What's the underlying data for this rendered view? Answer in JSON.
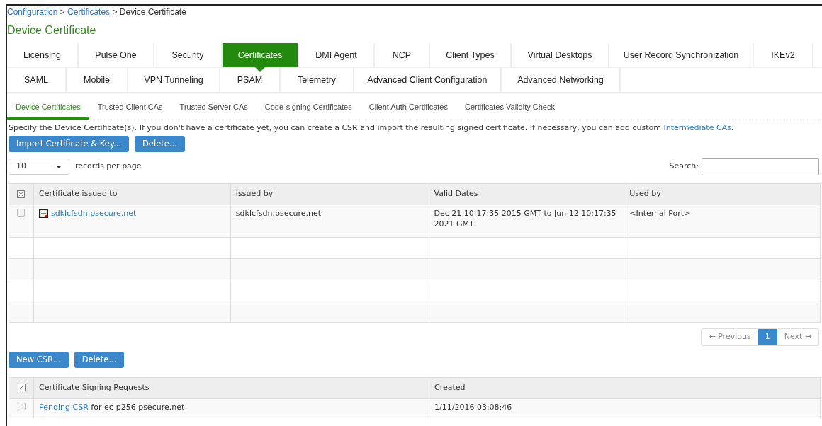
{
  "breadcrumb_separator": ">",
  "breadcrumb": [
    {
      "label": "Configuration",
      "link": true
    },
    {
      "label": "Certificates",
      "link": true
    },
    {
      "label": "Device Certificate",
      "link": false
    }
  ],
  "title": "Device Certificate",
  "tab_rows": [
    [
      {
        "label": "Licensing",
        "selected": false
      },
      {
        "label": "Pulse One",
        "selected": false
      },
      {
        "label": "Security",
        "selected": false
      },
      {
        "label": "Certificates",
        "selected": true
      },
      {
        "label": "DMI Agent",
        "selected": false
      },
      {
        "label": "NCP",
        "selected": false
      },
      {
        "label": "Client Types",
        "selected": false
      },
      {
        "label": "Virtual Desktops",
        "selected": false
      },
      {
        "label": "User Record Synchronization",
        "selected": false
      },
      {
        "label": "IKEv2",
        "selected": false
      }
    ],
    [
      {
        "label": "SAML",
        "selected": false
      },
      {
        "label": "Mobile",
        "selected": false
      },
      {
        "label": "VPN Tunneling",
        "selected": false
      },
      {
        "label": "PSAM",
        "selected": false
      },
      {
        "label": "Telemetry",
        "selected": false
      },
      {
        "label": "Advanced Client Configuration",
        "selected": false
      },
      {
        "label": "Advanced Networking",
        "selected": false
      }
    ]
  ],
  "subtabs": [
    {
      "label": "Device Certificates",
      "selected": true
    },
    {
      "label": "Trusted Client CAs",
      "selected": false
    },
    {
      "label": "Trusted Server CAs",
      "selected": false
    },
    {
      "label": "Code-signing Certificates",
      "selected": false
    },
    {
      "label": "Client Auth Certificates",
      "selected": false
    },
    {
      "label": "Certificates Validity Check",
      "selected": false
    }
  ],
  "description": {
    "text": "Specify the Device Certificate(s). If you don't have a certificate yet, you can create a CSR and import the resulting signed certificate. If necessary, you can add custom ",
    "link": "Intermediate CAs",
    "end": "."
  },
  "buttons": [
    "Import Certificate & Key...",
    "Delete..."
  ],
  "page_size": {
    "value": "10",
    "label": "records per page"
  },
  "search": {
    "label": "Search:"
  },
  "certificates": {
    "columns": [
      "Certificate issued to",
      "Issued by",
      "Valid Dates",
      "Used by"
    ],
    "rows": [
      {
        "checked": false,
        "issued_to": "sdklcfsdn.psecure.net",
        "issued_by": "sdklcfsdn.psecure.net",
        "valid_dates": "Dec 21 10:17:35 2015 GMT to Jun 12 10:17:35 2021 GMT",
        "used_by": "<Internal Port>"
      }
    ]
  },
  "pagination": [
    {
      "label": "← Previous",
      "selected": false
    },
    {
      "label": "1",
      "selected": true
    },
    {
      "label": "Next →",
      "selected": false
    }
  ],
  "csr_buttons": [
    "New CSR...",
    "Delete..."
  ],
  "csr_table": {
    "columns": [
      "Certificate Signing Requests",
      "Created"
    ],
    "rows": [
      {
        "checked": false,
        "link": "Pending CSR",
        "text": " for ec-p256.psecure.net",
        "created": "1/11/2016 03:08:46"
      }
    ]
  }
}
